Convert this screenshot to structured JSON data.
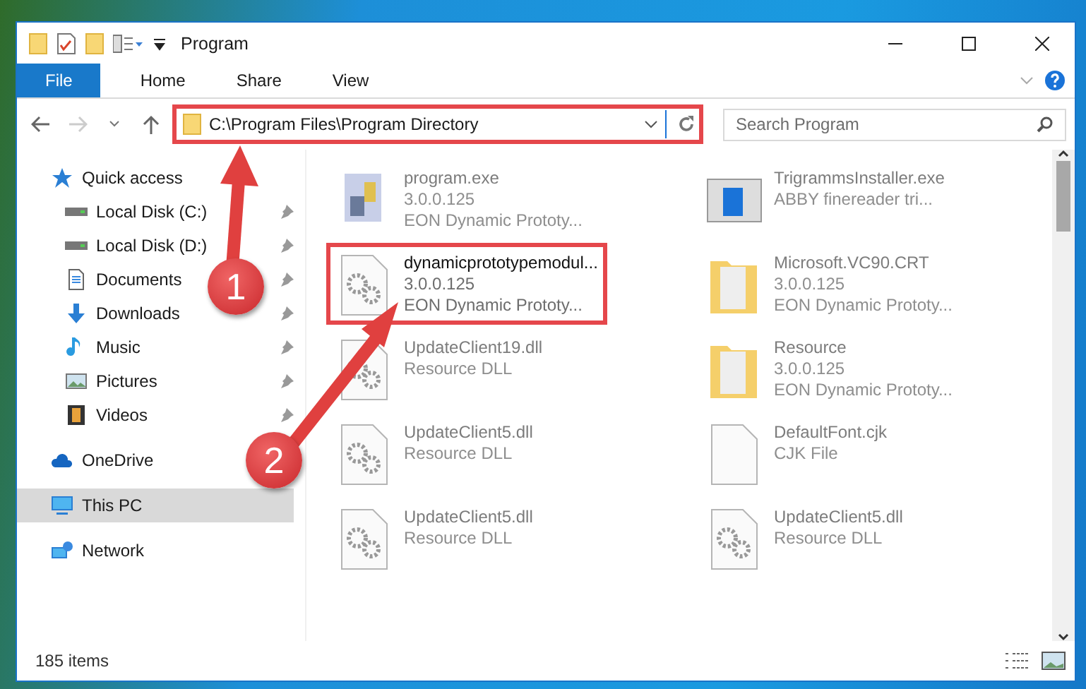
{
  "window": {
    "title": "Program"
  },
  "ribbon_tabs": [
    {
      "label": "File",
      "kind": "file"
    },
    {
      "label": "Home",
      "kind": "tab"
    },
    {
      "label": "Share",
      "kind": "tab"
    },
    {
      "label": "View",
      "kind": "tab"
    }
  ],
  "address_bar": {
    "path": "C:\\Program Files\\Program Directory",
    "highlighted": true
  },
  "search": {
    "placeholder": "Search Program"
  },
  "sidebar": {
    "items": [
      {
        "label": "Quick access",
        "kind": "star",
        "pinned": false,
        "selected": false
      },
      {
        "label": "Local Disk (C:)",
        "kind": "drive",
        "pinned": true,
        "selected": false
      },
      {
        "label": "Local Disk (D:)",
        "kind": "drive",
        "pinned": true,
        "selected": false
      },
      {
        "label": "Documents",
        "kind": "document",
        "pinned": true,
        "selected": false
      },
      {
        "label": "Downloads",
        "kind": "download",
        "pinned": true,
        "selected": false
      },
      {
        "label": "Music",
        "kind": "music",
        "pinned": true,
        "selected": false
      },
      {
        "label": "Pictures",
        "kind": "picture",
        "pinned": true,
        "selected": false
      },
      {
        "label": "Videos",
        "kind": "video",
        "pinned": true,
        "selected": false
      },
      {
        "label": "OneDrive",
        "kind": "cloud",
        "pinned": false,
        "selected": false
      },
      {
        "label": "This PC",
        "kind": "pc",
        "pinned": false,
        "selected": true
      },
      {
        "label": "Network",
        "kind": "network",
        "pinned": false,
        "selected": false
      }
    ]
  },
  "files": [
    {
      "kind": "app",
      "lines": [
        "program.exe",
        "3.0.0.125",
        "EON Dynamic Prototy..."
      ],
      "highlighted": false,
      "blurred": true
    },
    {
      "kind": "window",
      "lines": [
        "TrigrammsInstaller.exe",
        "ABBY finereader tri..."
      ],
      "highlighted": false,
      "blurred": true
    },
    {
      "kind": "gear",
      "lines": [
        "dynamicprototypemodul...",
        "3.0.0.125",
        "EON Dynamic Prototy..."
      ],
      "highlighted": true,
      "blurred": false
    },
    {
      "kind": "folder",
      "lines": [
        "Microsoft.VC90.CRT",
        "3.0.0.125",
        "EON Dynamic Prototy..."
      ],
      "highlighted": false,
      "blurred": true
    },
    {
      "kind": "gear",
      "lines": [
        "UpdateClient19.dll",
        "Resource DLL"
      ],
      "highlighted": false,
      "blurred": true
    },
    {
      "kind": "folder",
      "lines": [
        "Resource",
        "3.0.0.125",
        "EON Dynamic Prototy..."
      ],
      "highlighted": false,
      "blurred": true
    },
    {
      "kind": "gear",
      "lines": [
        "UpdateClient5.dll",
        "Resource DLL"
      ],
      "highlighted": false,
      "blurred": true
    },
    {
      "kind": "blank",
      "lines": [
        "DefaultFont.cjk",
        "CJK File"
      ],
      "highlighted": false,
      "blurred": true
    },
    {
      "kind": "gear",
      "lines": [
        "UpdateClient5.dll",
        "Resource DLL"
      ],
      "highlighted": false,
      "blurred": true
    },
    {
      "kind": "gear",
      "lines": [
        "UpdateClient5.dll",
        "Resource DLL"
      ],
      "highlighted": false,
      "blurred": true
    }
  ],
  "status_bar": {
    "count": "185 items"
  },
  "callouts": [
    {
      "number": "1"
    },
    {
      "number": "2"
    }
  ]
}
